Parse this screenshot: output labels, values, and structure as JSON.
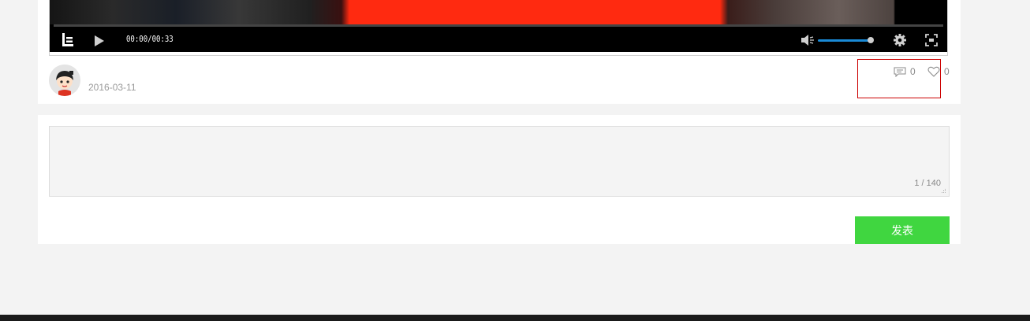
{
  "player": {
    "current_time": "00:00",
    "duration": "00:33",
    "time_display": "00:00/00:33",
    "progress": 0,
    "volume_level": 1.0,
    "accent_color": "#1a8ad6"
  },
  "post": {
    "date": "2016-03-11",
    "comment_count": "0",
    "like_count": "0",
    "icons": {
      "comments": "comment-icon",
      "likes": "heart-icon"
    }
  },
  "composer": {
    "text": "",
    "char_count": "1 / 140",
    "submit_label": "发表",
    "submit_color": "#40d640"
  },
  "annotation": {
    "highlight_color": "#cc0000"
  }
}
